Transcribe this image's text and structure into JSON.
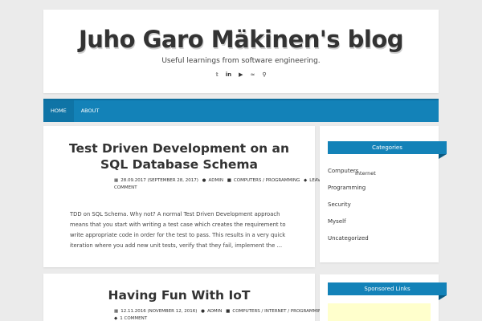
{
  "header": {
    "title": "Juho Garo Mäkinen's blog",
    "tagline": "Useful learnings from software engineering.",
    "social_icons": [
      "twitter-icon",
      "linkedin-icon",
      "youtube-icon",
      "rss-icon",
      "search-icon"
    ]
  },
  "nav": {
    "items": [
      "HOME",
      "ABOUT"
    ]
  },
  "posts": [
    {
      "title": "Test Driven Development on an SQL Database Schema",
      "date": "28.09.2017 (SEPTEMBER 28, 2017)",
      "author": "ADMIN",
      "categories": "COMPUTERS / PROGRAMMING",
      "comment": "LEAVE A COMMENT",
      "excerpt": "TDD on SQL Schema. Why not? A normal Test Driven Development approach means that you start with writing a test case which creates the requirement to write appropriate code in order for the test to pass. This results in a very quick iteration where you add new unit tests, verify that they fail, implement the …"
    },
    {
      "title": "Having Fun With IoT",
      "date": "12.11.2016 (NOVEMBER 12, 2016)",
      "author": "ADMIN",
      "categories": "COMPUTERS / INTERNET / PROGRAMMING",
      "comment": "1 COMMENT"
    }
  ],
  "sidebar": {
    "categories_title": "Categories",
    "categories": [
      "Computers",
      "Programming",
      "Security",
      "Myself",
      "Uncategorized"
    ],
    "subcategory": "Internet",
    "sponsored_title": "Sponsored Links"
  }
}
